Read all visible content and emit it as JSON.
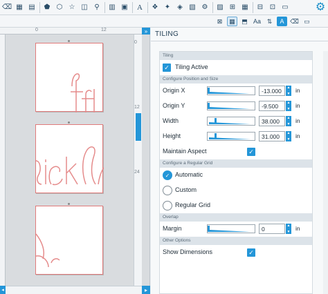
{
  "toolbar": {
    "icons": [
      "eraser-icon",
      "grid-icon",
      "pentagon-icon",
      "polygon-icon",
      "star-icon",
      "shape-icon",
      "node-icon",
      "hatch-icon",
      "grid-fine-icon",
      "text-icon",
      "weld-icon",
      "offset-icon",
      "trace-icon",
      "align-icon",
      "replicate-icon",
      "modify-icon",
      "transform-icon",
      "grid-large-icon",
      "layers-icon",
      "table-icon"
    ],
    "text_glyph": "A"
  },
  "panel": {
    "title": "TILING",
    "tiling_section": "Tiling",
    "tiling_active_label": "Tiling Active",
    "tiling_active_checked": true,
    "position_section": "Configure Position and Size",
    "fields": [
      {
        "label": "Origin X",
        "value": "-13.000",
        "unit": "in",
        "slider_fraction": 0.0
      },
      {
        "label": "Origin Y",
        "value": "-9.500",
        "unit": "in",
        "slider_fraction": 0.0
      },
      {
        "label": "Width",
        "value": "38.000",
        "unit": "in",
        "slider_fraction": 0.15
      },
      {
        "label": "Height",
        "value": "31.000",
        "unit": "in",
        "slider_fraction": 0.15
      }
    ],
    "maintain_aspect_label": "Maintain Aspect",
    "maintain_aspect_checked": true,
    "grid_section": "Configure a Regular Grid",
    "radio_options": [
      "Automatic",
      "Custom",
      "Regular Grid"
    ],
    "radio_selected": "Automatic",
    "overlap_section": "Overlap",
    "margin_label": "Margin",
    "margin_value": "0",
    "margin_unit": "in",
    "other_section": "Other Options",
    "show_dimensions_label": "Show Dimensions",
    "show_dimensions_checked": true
  },
  "canvas": {
    "ruler_top_labels": [
      "0",
      "12"
    ],
    "ruler_side_labels": [
      "0",
      "12",
      "24"
    ]
  },
  "colors": {
    "accent": "#2496d8",
    "tile_outline": "#e07a7a"
  }
}
